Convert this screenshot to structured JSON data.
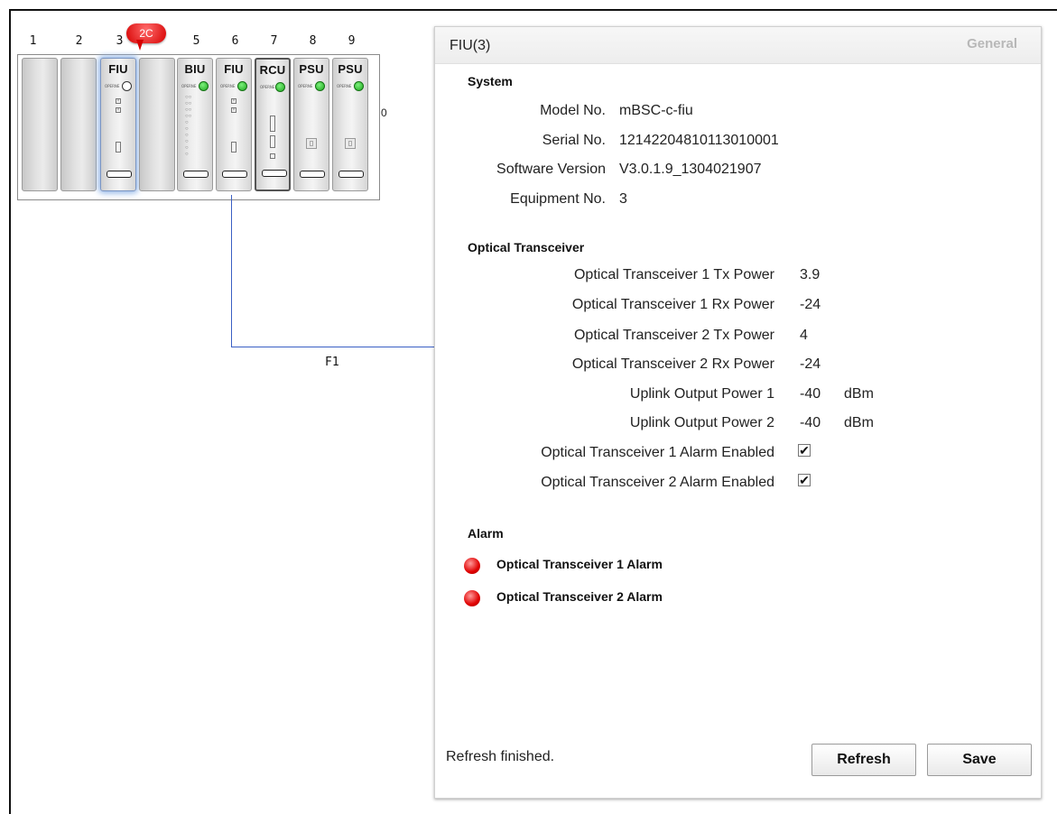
{
  "chassis": {
    "slot_numbers": [
      "1",
      "2",
      "3",
      "5",
      "6",
      "7",
      "8",
      "9"
    ],
    "side_label": "0",
    "alarm_badge": "2C",
    "cards": {
      "fiu3": {
        "label": "FIU",
        "oper": "OPERNE"
      },
      "biu5": {
        "label": "BIU",
        "oper": "OPERNE"
      },
      "fiu6": {
        "label": "FIU",
        "oper": "OPERNE"
      },
      "rcu7": {
        "label": "RCU",
        "oper": "OPERNE"
      },
      "psu8": {
        "label": "PSU",
        "oper": "OPERNE"
      },
      "psu9": {
        "label": "PSU",
        "oper": "OPERNE"
      }
    },
    "link_label": "F1"
  },
  "panel": {
    "title": "FIU(3)",
    "tab": "General",
    "system": {
      "heading": "System",
      "model_label": "Model No.",
      "model_value": "mBSC-c-fiu",
      "serial_label": "Serial No.",
      "serial_value": "12142204810113010001",
      "software_label": "Software Version",
      "software_value": "V3.0.1.9_1304021907",
      "equipment_label": "Equipment No.",
      "equipment_value": "3"
    },
    "optical": {
      "heading": "Optical Transceiver",
      "rows": [
        {
          "label": "Optical Transceiver 1 Tx Power",
          "value": "3.9",
          "unit": ""
        },
        {
          "label": "Optical Transceiver 1 Rx Power",
          "value": "-24",
          "unit": ""
        },
        {
          "label": "Optical Transceiver 2 Tx Power",
          "value": "4",
          "unit": ""
        },
        {
          "label": "Optical Transceiver 2 Rx Power",
          "value": "-24",
          "unit": ""
        },
        {
          "label": "Uplink Output Power 1",
          "value": "-40",
          "unit": "dBm"
        },
        {
          "label": "Uplink Output Power 2",
          "value": "-40",
          "unit": "dBm"
        }
      ],
      "alarm1_enabled_label": "Optical Transceiver 1 Alarm Enabled",
      "alarm2_enabled_label": "Optical Transceiver 2 Alarm Enabled",
      "check_mark": "✔"
    },
    "alarm": {
      "heading": "Alarm",
      "items": [
        "Optical Transceiver 1 Alarm",
        "Optical Transceiver 2 Alarm"
      ]
    },
    "status": "Refresh finished.",
    "refresh_label": "Refresh",
    "save_label": "Save"
  }
}
